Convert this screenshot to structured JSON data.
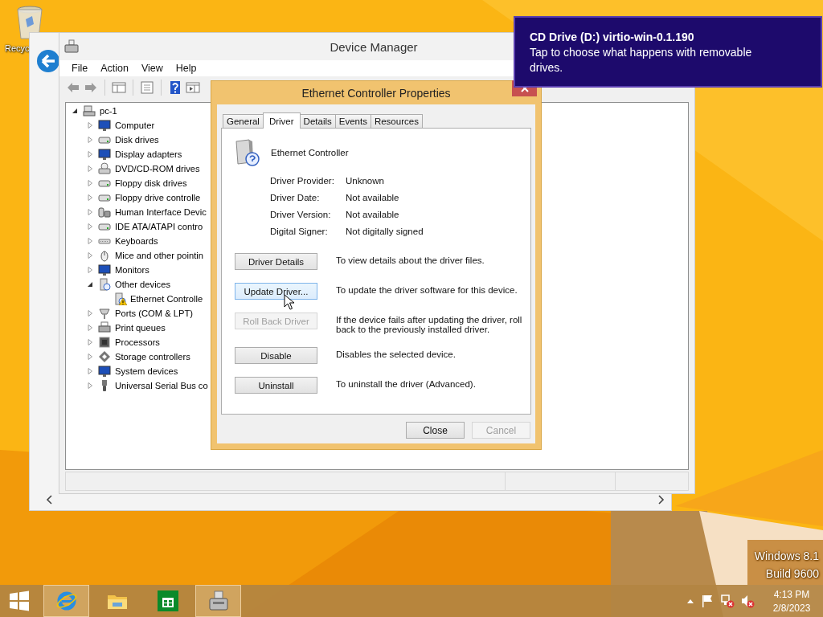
{
  "desktop": {
    "icons": [
      {
        "label": "Recyc"
      }
    ],
    "watermark": [
      "Windows 8.1",
      "Build 9600"
    ]
  },
  "device_manager": {
    "title": "Device Manager",
    "menu": [
      "File",
      "Action",
      "View",
      "Help"
    ],
    "tree": [
      {
        "label": "pc-1",
        "expanded": true,
        "children": [
          {
            "label": "Computer",
            "expanded": false
          },
          {
            "label": "Disk drives",
            "expanded": false
          },
          {
            "label": "Display adapters",
            "expanded": false
          },
          {
            "label": "DVD/CD-ROM drives",
            "expanded": false
          },
          {
            "label": "Floppy disk drives",
            "expanded": false
          },
          {
            "label": "Floppy drive controlle",
            "expanded": false
          },
          {
            "label": "Human Interface Devic",
            "expanded": false
          },
          {
            "label": "IDE ATA/ATAPI contro",
            "expanded": false
          },
          {
            "label": "Keyboards",
            "expanded": false
          },
          {
            "label": "Mice and other pointin",
            "expanded": false
          },
          {
            "label": "Monitors",
            "expanded": false
          },
          {
            "label": "Other devices",
            "expanded": true,
            "children": [
              {
                "label": "Ethernet Controlle",
                "warning": true
              }
            ]
          },
          {
            "label": "Ports (COM & LPT)",
            "expanded": false
          },
          {
            "label": "Print queues",
            "expanded": false
          },
          {
            "label": "Processors",
            "expanded": false
          },
          {
            "label": "Storage controllers",
            "expanded": false
          },
          {
            "label": "System devices",
            "expanded": false
          },
          {
            "label": "Universal Serial Bus co",
            "expanded": false
          }
        ]
      }
    ]
  },
  "properties_dialog": {
    "title": "Ethernet Controller Properties",
    "tabs": [
      {
        "label": "General",
        "selected": false
      },
      {
        "label": "Driver",
        "selected": true
      },
      {
        "label": "Details",
        "selected": false
      },
      {
        "label": "Events",
        "selected": false
      },
      {
        "label": "Resources",
        "selected": false
      }
    ],
    "device_name": "Ethernet Controller",
    "fields": [
      {
        "label": "Driver Provider:",
        "value": "Unknown"
      },
      {
        "label": "Driver Date:",
        "value": "Not available"
      },
      {
        "label": "Driver Version:",
        "value": "Not available"
      },
      {
        "label": "Digital Signer:",
        "value": "Not digitally signed"
      }
    ],
    "actions": [
      {
        "button": "Driver Details",
        "description": "To view details about the driver files.",
        "disabled": false,
        "hovered": false
      },
      {
        "button": "Update Driver...",
        "description": "To update the driver software for this device.",
        "disabled": false,
        "hovered": true
      },
      {
        "button": "Roll Back Driver",
        "description": "If the device fails after updating the driver, roll back to the previously installed driver.",
        "disabled": true,
        "hovered": false
      },
      {
        "button": "Disable",
        "description": "Disables the selected device.",
        "disabled": false,
        "hovered": false
      },
      {
        "button": "Uninstall",
        "description": "To uninstall the driver (Advanced).",
        "disabled": false,
        "hovered": false
      }
    ],
    "buttons": [
      {
        "label": "Close",
        "disabled": false
      },
      {
        "label": "Cancel",
        "disabled": true
      }
    ]
  },
  "notification": {
    "title": "CD Drive (D:) virtio-win-0.1.190",
    "message": "Tap to choose what happens with removable drives."
  },
  "taskbar": {
    "apps": [
      {
        "active": true
      },
      {
        "active": false
      },
      {
        "active": false
      },
      {
        "active": true
      }
    ],
    "clock": {
      "time": "4:13 PM",
      "date": "2/8/2023"
    }
  }
}
